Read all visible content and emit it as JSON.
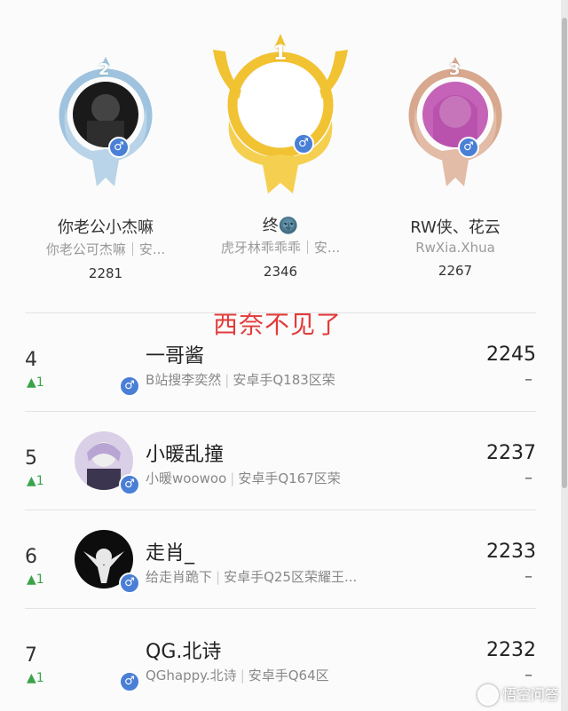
{
  "podium": {
    "first": {
      "rank": "1",
      "name": "终🌚",
      "sub": "虎牙林乖乖乖｜安...",
      "score": "2346",
      "gender": "♂"
    },
    "second": {
      "rank": "2",
      "name": "你老公小杰嘛",
      "sub": "你老公可杰嘛｜安...",
      "score": "2281",
      "gender": "♂"
    },
    "third": {
      "rank": "3",
      "name": "RW侠、花云",
      "sub": "RwXia.Xhua",
      "score": "2267",
      "gender": "♂"
    }
  },
  "annotation": "西奈不见了",
  "rows": [
    {
      "rank": "4",
      "delta": "▲1",
      "name": "一哥酱",
      "sub_a": "B站搜李奕然",
      "sub_b": "安卓手Q183区荣",
      "score": "2245",
      "dash": "–",
      "gender": "♂"
    },
    {
      "rank": "5",
      "delta": "▲1",
      "name": "小暖乱撞",
      "sub_a": "小暖woowoo",
      "sub_b": "安卓手Q167区荣",
      "score": "2237",
      "dash": "–",
      "gender": "♂"
    },
    {
      "rank": "6",
      "delta": "▲1",
      "name": "走肖_",
      "sub_a": "给走肖跪下",
      "sub_b": "安卓手Q25区荣耀王...",
      "score": "2233",
      "dash": "–",
      "gender": "♂"
    },
    {
      "rank": "7",
      "delta": "▲1",
      "name": "QG.北诗",
      "sub_a": "QGhappy.北诗",
      "sub_b": "安卓手Q64区",
      "score": "2232",
      "dash": "–",
      "gender": "♂"
    }
  ],
  "watermark": "悟空问答",
  "colors": {
    "gold": "#f1c232",
    "silver": "#9fc3de",
    "bronze": "#d7a88e",
    "badge": "#4a7fd6",
    "delta": "#3aa34a",
    "annotation": "#e23b3b"
  },
  "icons": {
    "gender": "male-icon",
    "delta": "up-arrow-icon"
  }
}
